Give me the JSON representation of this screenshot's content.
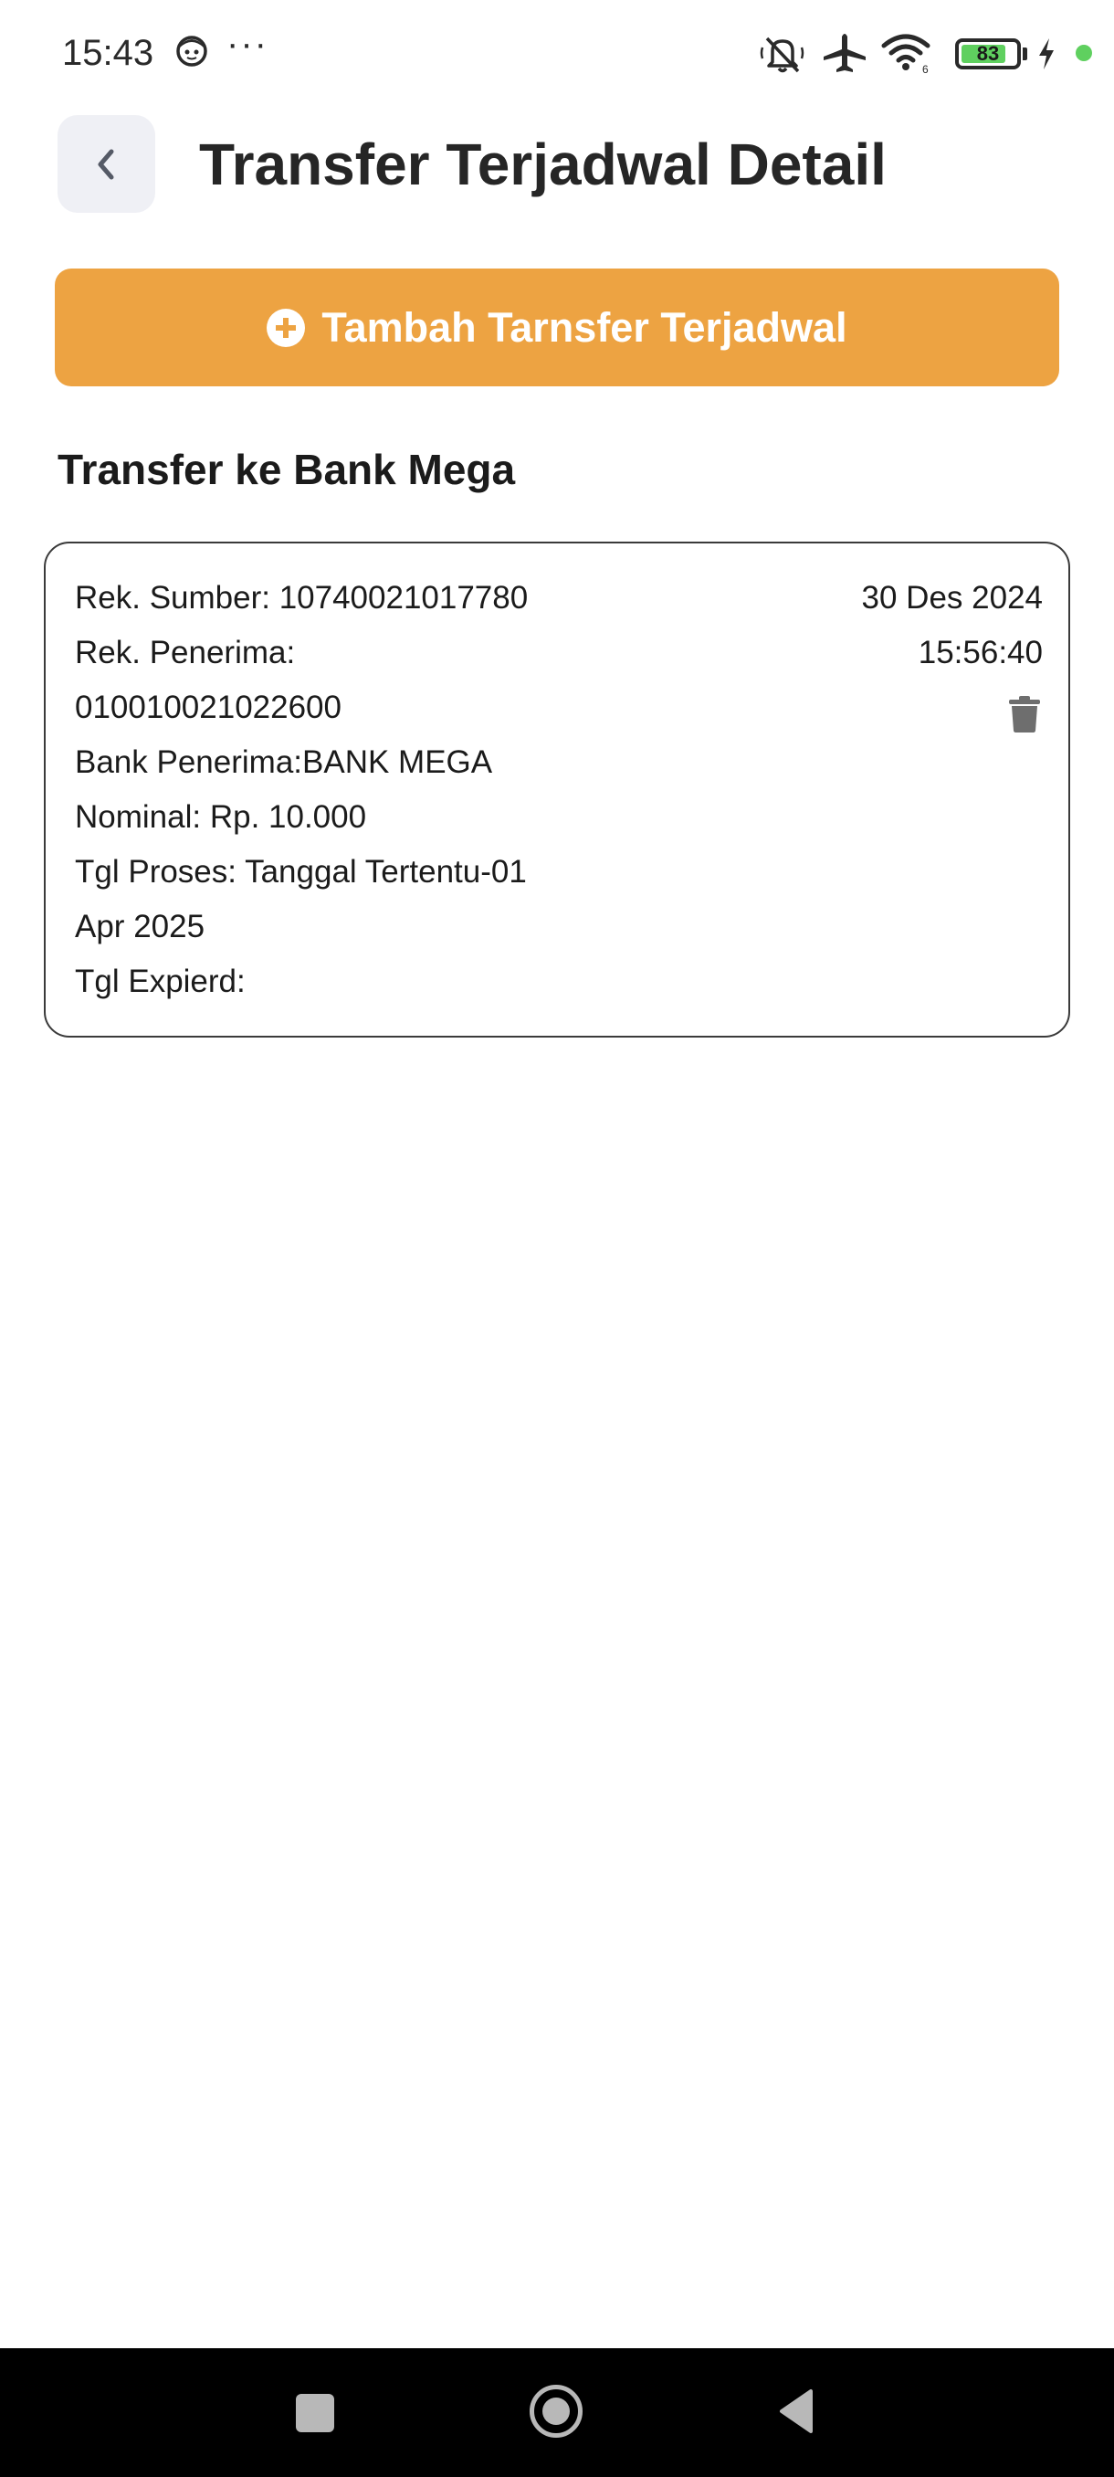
{
  "status_bar": {
    "time": "15:43",
    "dots": "···",
    "battery": "83",
    "battery_level": 0.83,
    "icons": [
      "face-icon",
      "mute-icon",
      "airplane-icon",
      "wifi-icon",
      "battery-icon",
      "charging-icon",
      "green-dot"
    ]
  },
  "header": {
    "title": "Transfer Terjadwal Detail",
    "back_icon": "chevron-left-icon"
  },
  "add_button": {
    "label": "Tambah Tarnsfer Terjadwal",
    "icon": "plus-circle-icon"
  },
  "section": {
    "title": "Transfer ke Bank Mega"
  },
  "card": {
    "lines": [
      "Rek. Sumber: 10740021017780",
      "Rek. Penerima:",
      "010010021022600",
      "Bank Penerima:BANK MEGA",
      "Nominal: Rp. 10.000",
      "Tgl Proses: Tanggal Tertentu-01",
      "Apr 2025",
      "Tgl Expierd:"
    ],
    "date": "30 Des 2024",
    "time": "15:56:40",
    "delete_icon": "trash-icon"
  },
  "colors": {
    "accent": "#eda342",
    "back_button_bg": "#eff0f5",
    "card_border": "#3a3a3a",
    "nav_bar_bg": "#000000"
  }
}
